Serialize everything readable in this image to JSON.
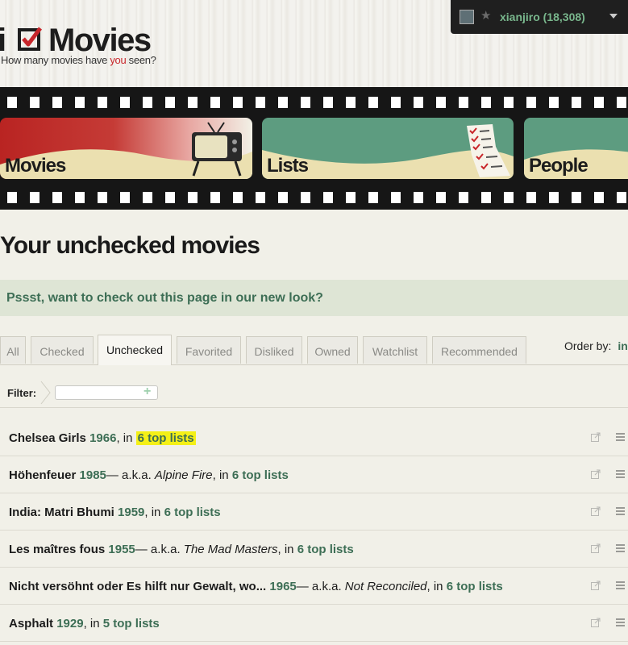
{
  "header": {
    "logo_i": "i",
    "logo_text": "Movies",
    "tagline_pre": "How many movies have ",
    "tagline_you": "you",
    "tagline_post": " seen?",
    "user": {
      "name": "xianjiro (18,308)"
    }
  },
  "nav": {
    "tabs": [
      {
        "label": "Movies"
      },
      {
        "label": "Lists"
      },
      {
        "label": "People"
      }
    ]
  },
  "page": {
    "title": "Your unchecked movies",
    "notice": "Pssst, want to check out this page in our new look?"
  },
  "filter_tabs": [
    "All",
    "Checked",
    "Unchecked",
    "Favorited",
    "Disliked",
    "Owned",
    "Watchlist",
    "Recommended"
  ],
  "active_tab": "Unchecked",
  "order_by": {
    "label": "Order by:",
    "value": "in"
  },
  "filter": {
    "label": "Filter:",
    "value": ""
  },
  "movies": [
    {
      "title": "Chelsea Girls",
      "year": "1966",
      "sep": ", in ",
      "aka_pre": "",
      "aka": "",
      "lists": "6 top lists",
      "highlight": true
    },
    {
      "title": "Höhenfeuer",
      "year": "1985",
      "sep": ", in ",
      "aka_pre": "— a.k.a. ",
      "aka": "Alpine Fire",
      "lists": "6 top lists",
      "highlight": false
    },
    {
      "title": "India: Matri Bhumi",
      "year": "1959",
      "sep": ", in ",
      "aka_pre": "",
      "aka": "",
      "lists": "6 top lists",
      "highlight": false
    },
    {
      "title": "Les maîtres fous",
      "year": "1955",
      "sep": ", in ",
      "aka_pre": "— a.k.a. ",
      "aka": "The Mad Masters",
      "lists": "6 top lists",
      "highlight": false
    },
    {
      "title": "Nicht versöhnt oder Es hilft nur Gewalt, wo...",
      "year": "1965",
      "sep": ", in ",
      "aka_pre": "— a.k.a. ",
      "aka": "Not Reconciled",
      "lists": "6 top lists",
      "highlight": false
    },
    {
      "title": "Asphalt",
      "year": "1929",
      "sep": ", in ",
      "aka_pre": "",
      "aka": "",
      "lists": "5 top lists",
      "highlight": false
    }
  ],
  "colors": {
    "accent_green": "#3d6e55",
    "highlight_yellow": "#f4f017",
    "brand_red": "#c8262b"
  }
}
